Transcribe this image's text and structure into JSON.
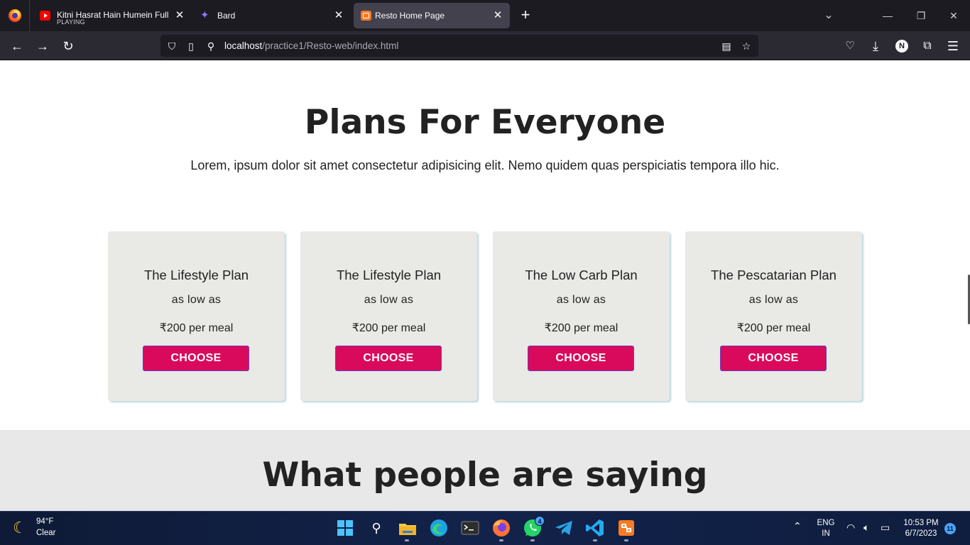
{
  "browser": {
    "tabs": [
      {
        "title": "Kitni Hasrat Hain Humein Full V",
        "subtitle": "PLAYING",
        "icon": "youtube-icon"
      },
      {
        "title": "Bard",
        "icon": "bard-icon"
      },
      {
        "title": "Resto Home Page",
        "icon": "xampp-icon",
        "active": true
      }
    ],
    "url": {
      "host": "localhost",
      "path": "/practice1/Resto-web/index.html"
    },
    "account_initial": "N"
  },
  "page": {
    "plans_title": "Plans For Everyone",
    "plans_subtitle": "Lorem, ipsum dolor sit amet consectetur adipisicing elit. Nemo quidem quas perspiciatis tempora illo hic.",
    "plans": [
      {
        "name": "The Lifestyle Plan",
        "tagline": "as low as",
        "price": "₹200 per meal",
        "button": "CHOOSE"
      },
      {
        "name": "The Lifestyle Plan",
        "tagline": "as low as",
        "price": "₹200 per meal",
        "button": "CHOOSE"
      },
      {
        "name": "The Low Carb Plan",
        "tagline": "as low as",
        "price": "₹200 per meal",
        "button": "CHOOSE"
      },
      {
        "name": "The Pescatarian Plan",
        "tagline": "as low as",
        "price": "₹200 per meal",
        "button": "CHOOSE"
      }
    ],
    "testimonial_title": "What people are saying",
    "colors": {
      "button": "#d90a5b",
      "card": "#e9e9e5",
      "testimonial_bg": "#e8e8e8"
    }
  },
  "taskbar": {
    "weather": {
      "temp": "94°F",
      "condition": "Clear"
    },
    "whatsapp_badge": "4",
    "language": {
      "line1": "ENG",
      "line2": "IN"
    },
    "time": "10:53 PM",
    "date": "6/7/2023",
    "notification_count": "11"
  }
}
